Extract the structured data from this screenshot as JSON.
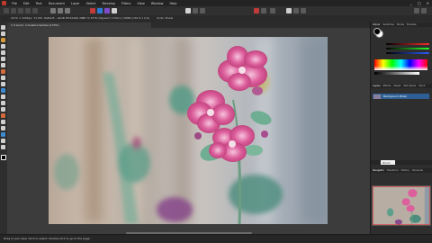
{
  "menu": {
    "items": [
      "File",
      "Edit",
      "Text",
      "Document",
      "Layer",
      "Select",
      "Develop",
      "Filters",
      "View",
      "Window",
      "Help"
    ]
  },
  "window_controls": [
    "_",
    "□",
    "×"
  ],
  "context_bar": {
    "info1": "2979 × 2098px, 72 DPI, RGBA/8 – sRGB IEC61966-2.1",
    "info2": "WB 72 6730 (Nguse?) 1700/1 | MRMI (CS9 6.1 0.6)",
    "info3": "Units: Pixels"
  },
  "document_tab": {
    "title": "1.3 zoom: a tonehre tantwa (170%)"
  },
  "panel": {
    "top_tabs": [
      "Colour",
      "Swatches",
      "Stroke",
      "Brushes"
    ],
    "active_top_tab": "Colour",
    "mid_tabs": [
      "Layers",
      "Effects",
      "Styles",
      "Text Styles",
      "Stock"
    ],
    "layer_name": "Background (Pixel)",
    "lower_tabs": [
      "Navigator",
      "Transform",
      "History",
      "Channels"
    ],
    "tooltip": "Zoom"
  },
  "status": {
    "text": "Drag to pan view. Click to select. Double-click to go to the page."
  },
  "colors": {
    "accent": "#2d5f95",
    "flower": "#d15b95",
    "bg": "#2b2b2b"
  }
}
